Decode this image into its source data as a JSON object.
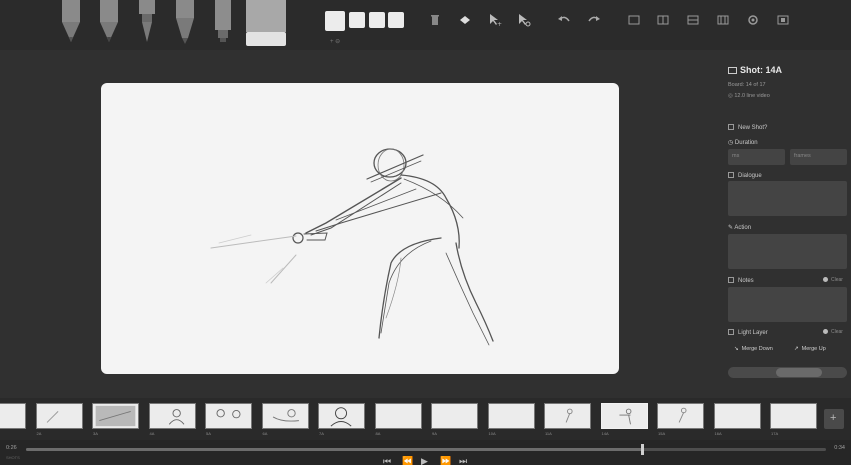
{
  "colors": {
    "background": "#303030",
    "canvas": "#f4f4f4",
    "panel_field": "#444444",
    "accent_light": "#ececec"
  },
  "toolbar": {
    "tools": [
      "light-pencil-icon",
      "pencil-icon",
      "pen-icon",
      "brush-icon",
      "note-pen-icon",
      "eraser-icon"
    ],
    "swatches_caption": "+ ⊖",
    "icons": [
      "trash-icon",
      "fill-icon",
      "move-icon",
      "scale-icon",
      "undo-icon",
      "redo-icon",
      "layout-icon",
      "grid-icon",
      "center-icon",
      "thirds-icon",
      "settings-icon",
      "shot-icon"
    ]
  },
  "panel": {
    "title": "Shot: 14A",
    "board_info": "Board: 14 of 17",
    "video_label": "12.0 line video",
    "new_shot_label": "New Shot?",
    "duration_label": "Duration",
    "duration_ms_placeholder": "ms",
    "duration_frames_placeholder": "frames",
    "dialogue_label": "Dialogue",
    "action_label": "Action",
    "notes_label": "Notes",
    "clear_label": "Clear",
    "light_layer_label": "Light Layer",
    "merge_down_label": "Merge Down",
    "merge_up_label": "Merge Up"
  },
  "filmstrip": {
    "thumbs": [
      {
        "caption": "1",
        "info": ""
      },
      {
        "caption": "2A",
        "info": ""
      },
      {
        "caption": "3A",
        "info": ""
      },
      {
        "caption": "4A",
        "info": ""
      },
      {
        "caption": "5A",
        "info": ""
      },
      {
        "caption": "6A",
        "info": ""
      },
      {
        "caption": "7A",
        "info": ""
      },
      {
        "caption": "8A",
        "info": ""
      },
      {
        "caption": "9A",
        "info": ""
      },
      {
        "caption": "10A",
        "info": ""
      },
      {
        "caption": "11A",
        "info": ""
      },
      {
        "caption": "14A",
        "info": ""
      },
      {
        "caption": "15A",
        "info": ""
      },
      {
        "caption": "16A",
        "info": ""
      },
      {
        "caption": "17A",
        "info": ""
      }
    ],
    "selected_index": 11,
    "add_label": "+"
  },
  "timeline": {
    "time_current": "0:26",
    "time_total": "0:34",
    "sub_label": "SHOTS",
    "progress": 0.77,
    "controls": [
      "⏮",
      "⏪",
      "▶",
      "⏩",
      "⏭"
    ]
  }
}
